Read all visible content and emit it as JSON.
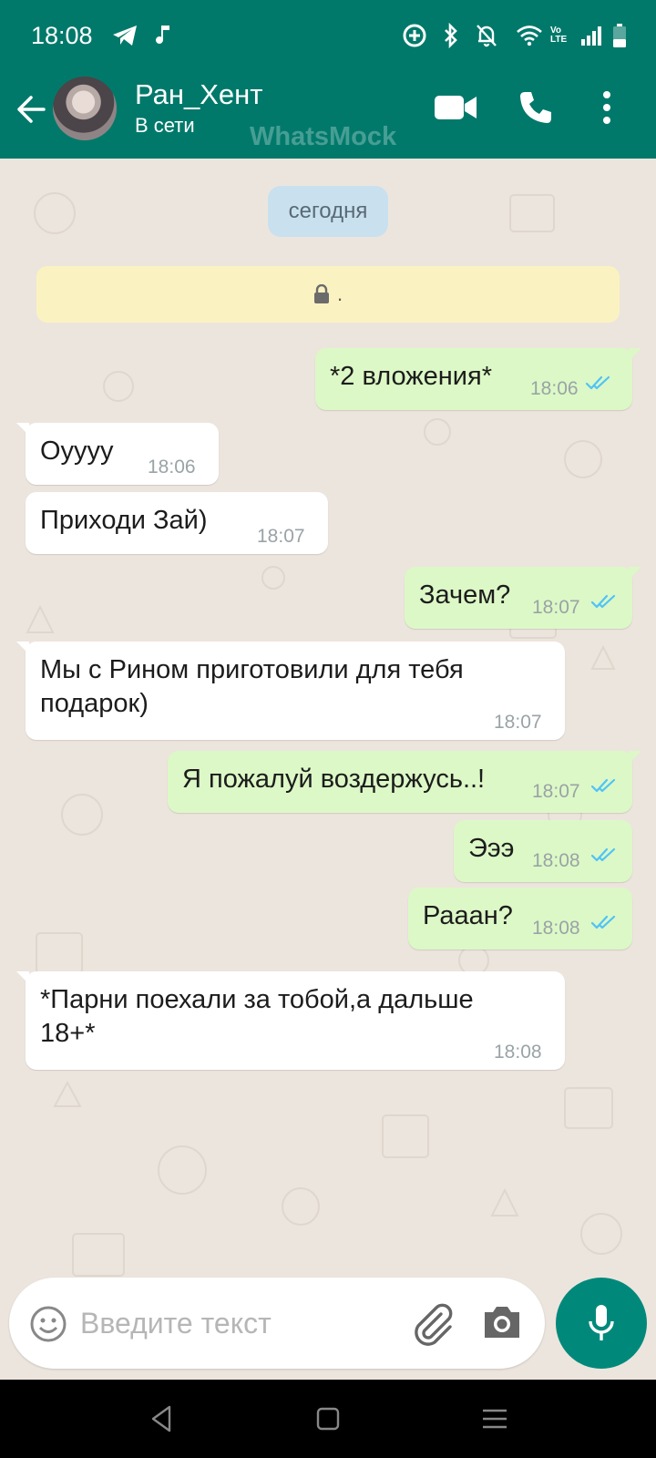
{
  "status_bar": {
    "time": "18:08",
    "icons": [
      "telegram-icon",
      "music-note-icon",
      "data-saver-icon",
      "bluetooth-icon",
      "notifications-off-icon",
      "wifi-icon",
      "volte-icon",
      "signal-icon",
      "battery-icon"
    ],
    "volte_label": "Vo LTE"
  },
  "header": {
    "contact_name": "Ран_Хент",
    "contact_status": "В сети",
    "watermark": "WhatsMock",
    "icons": [
      "back-arrow-icon",
      "video-call-icon",
      "phone-icon",
      "more-vert-icon"
    ]
  },
  "chat": {
    "date_label": "сегодня",
    "encryption_text": ".",
    "messages": [
      {
        "dir": "out",
        "lines": [
          "*2 вложения*"
        ],
        "time": "18:06",
        "read": true
      },
      {
        "dir": "in",
        "lines": [
          "Оуууу"
        ],
        "time": "18:06"
      },
      {
        "dir": "in",
        "lines": [
          "Приходи Зай)"
        ],
        "time": "18:07"
      },
      {
        "dir": "out",
        "lines": [
          "Зачем?"
        ],
        "time": "18:07",
        "read": true
      },
      {
        "dir": "in",
        "lines": [
          "Мы с Рином приготовили для тебя",
          "подарок)"
        ],
        "time": "18:07"
      },
      {
        "dir": "out",
        "lines": [
          "Я пожалуй воздержусь..!"
        ],
        "time": "18:07",
        "read": true
      },
      {
        "dir": "out",
        "lines": [
          "Эээ"
        ],
        "time": "18:08",
        "read": true
      },
      {
        "dir": "out",
        "lines": [
          "Рааан?"
        ],
        "time": "18:08",
        "read": true
      },
      {
        "dir": "in",
        "lines": [
          "*Парни поехали за тобой,а дальше",
          "18+*"
        ],
        "time": "18:08"
      }
    ]
  },
  "composer": {
    "placeholder": "Введите текст",
    "value": "",
    "icons": [
      "emoji-icon",
      "paperclip-icon",
      "camera-icon",
      "microphone-icon"
    ]
  },
  "nav_bar": {
    "icons": [
      "nav-back-icon",
      "nav-home-icon",
      "nav-menu-icon"
    ]
  },
  "colors": {
    "header": "#00796b",
    "chat_background": "#ece5dd",
    "outgoing_bubble": "#dcf8c6",
    "incoming_bubble": "#ffffff",
    "read_ticks": "#4fc3f7",
    "mic_button": "#00897b"
  }
}
